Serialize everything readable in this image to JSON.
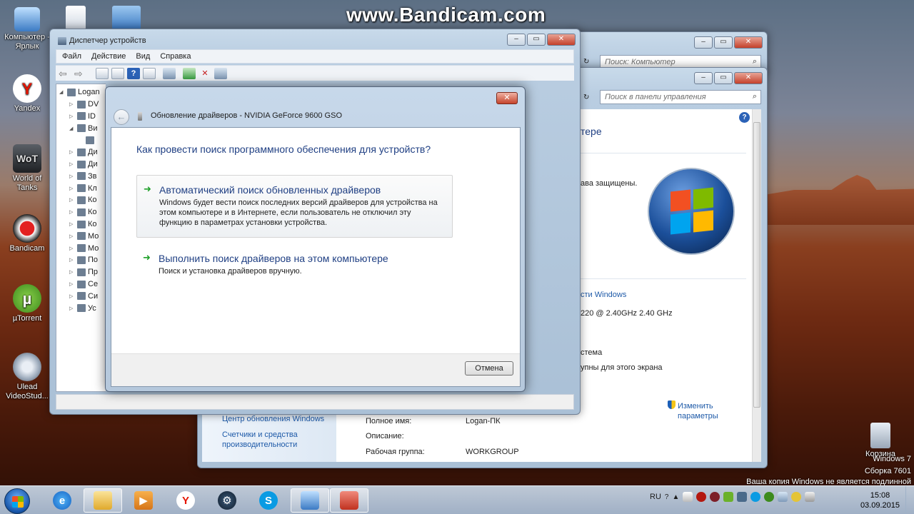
{
  "watermark": "www.Bandicam.com",
  "desktop_icons": [
    {
      "label": "Компьютер - Ярлык",
      "icon": "computer-icon"
    },
    {
      "label": "Yandex",
      "icon": "yandex-icon"
    },
    {
      "label": "World of Tanks",
      "icon": "wot-icon"
    },
    {
      "label": "Bandicam",
      "icon": "bandicam-icon"
    },
    {
      "label": "µTorrent",
      "icon": "utorrent-icon"
    },
    {
      "label": "Ulead VideoStud...",
      "icon": "ulead-icon"
    },
    {
      "label": "Корзина",
      "icon": "recycle-bin-icon"
    }
  ],
  "device_manager": {
    "title": "Диспетчер устройств",
    "menu": [
      "Файл",
      "Действие",
      "Вид",
      "Справка"
    ],
    "tree_root": "Logan",
    "tree_items": [
      "DV",
      "ID",
      "Ви",
      "",
      "Ди",
      "Ди",
      "Зв",
      "Кл",
      "Ко",
      "Ко",
      "Ко",
      "Мо",
      "Мо",
      "По",
      "Пр",
      "Се",
      "Си",
      "Ус"
    ]
  },
  "explorer_back": {
    "search_placeholder": "Поиск: Компьютер"
  },
  "control_panel": {
    "search_placeholder": "Поиск в панели управления",
    "partial_texts": [
      "тере",
      "ава защищены.",
      "сти Windows",
      "220  @ 2.40GHz   2.40 GHz",
      "стема",
      "упны для этого экрана"
    ],
    "change_settings": "Изменить параметры",
    "sidebar_links": [
      "Центр обновления Windows",
      "Счетчики и средства производительности"
    ],
    "computer_info": [
      {
        "label": "Полное имя:",
        "value": "Logan-ПК"
      },
      {
        "label": "Описание:",
        "value": ""
      },
      {
        "label": "Рабочая группа:",
        "value": "WORKGROUP"
      }
    ]
  },
  "wizard": {
    "title": "Обновление драйверов - NVIDIA GeForce 9600 GSO",
    "heading": "Как провести поиск программного обеспечения для устройств?",
    "option_auto": {
      "title": "Автоматический поиск обновленных драйверов",
      "desc": "Windows будет вести поиск последних версий драйверов для устройства на этом компьютере и в Интернете, если пользователь не отключил эту функцию в параметрах установки устройства."
    },
    "option_manual": {
      "title": "Выполнить поиск драйверов на этом компьютере",
      "desc": "Поиск и установка драйверов вручную."
    },
    "cancel": "Отмена"
  },
  "windows_notice": {
    "line1": "Windows 7",
    "line2": "Сборка 7601",
    "line3": "Ваша копия Windows не является подлинной"
  },
  "taskbar": {
    "lang": "RU",
    "time": "15:08",
    "date": "03.09.2015"
  },
  "colors": {
    "link": "#1e5aa8",
    "heading": "#1f3f83",
    "arrow": "#21a12b"
  }
}
